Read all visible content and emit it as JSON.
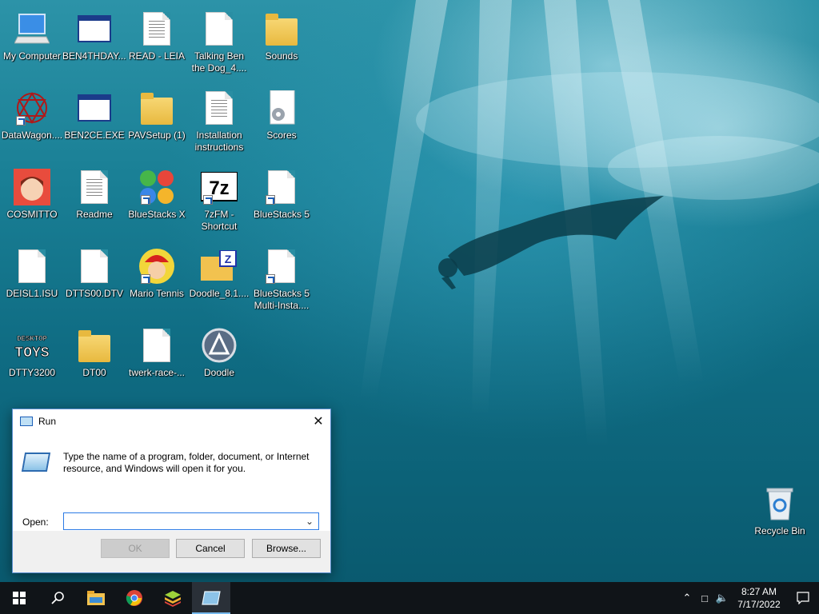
{
  "desktop": {
    "icons": [
      {
        "label": "My Computer",
        "icon": "computer-icon"
      },
      {
        "label": "BEN4THDAY....",
        "icon": "exe-window-icon"
      },
      {
        "label": "READ - LEIA",
        "icon": "text-file-icon"
      },
      {
        "label": "Talking Ben the Dog_4....",
        "icon": "file-icon"
      },
      {
        "label": "Sounds",
        "icon": "folder-icon"
      },
      {
        "label": "DataWagon....",
        "icon": "datawagon-icon"
      },
      {
        "label": "BEN2CE.EXE",
        "icon": "exe-window-icon"
      },
      {
        "label": "PAVSetup (1)",
        "icon": "folder-icon"
      },
      {
        "label": "Installation instructions",
        "icon": "text-file-icon"
      },
      {
        "label": "Scores",
        "icon": "settings-file-icon"
      },
      {
        "label": "COSMITTO",
        "icon": "avatar-icon"
      },
      {
        "label": "Readme",
        "icon": "text-file-icon"
      },
      {
        "label": "BlueStacks X",
        "icon": "bluestacks-x-icon"
      },
      {
        "label": "7zFM - Shortcut",
        "icon": "7zip-icon"
      },
      {
        "label": "BlueStacks 5",
        "icon": "file-icon"
      },
      {
        "label": "DEISL1.ISU",
        "icon": "file-icon"
      },
      {
        "label": "DTTS00.DTV",
        "icon": "file-icon"
      },
      {
        "label": "Mario Tennis",
        "icon": "mario-icon"
      },
      {
        "label": "Doodle_8.1....",
        "icon": "zip-folder-icon"
      },
      {
        "label": "BlueStacks 5 Multi-Insta....",
        "icon": "file-icon"
      },
      {
        "label": "DTTY3200",
        "icon": "desktop-toys-icon"
      },
      {
        "label": "DT00",
        "icon": "folder-icon"
      },
      {
        "label": "twerk-race-...",
        "icon": "file-icon"
      },
      {
        "label": "Doodle",
        "icon": "doodle-icon"
      }
    ],
    "recycle_bin": {
      "label": "Recycle Bin",
      "icon": "recycle-bin-icon"
    }
  },
  "run_dialog": {
    "title": "Run",
    "description": "Type the name of a program, folder, document, or Internet resource, and Windows will open it for you.",
    "open_label": "Open:",
    "open_value": "",
    "ok_label": "OK",
    "cancel_label": "Cancel",
    "browse_label": "Browse...",
    "close_glyph": "✕"
  },
  "taskbar": {
    "time": "8:27 AM",
    "date": "7/17/2022",
    "apps": [
      "start-icon",
      "search-icon",
      "file-explorer-icon",
      "chrome-icon",
      "bluestacks-icon",
      "run-icon"
    ]
  },
  "colors": {
    "taskbar_bg": "#101418",
    "accent": "#76b9ed",
    "dialog_border": "#5a8ed0"
  }
}
